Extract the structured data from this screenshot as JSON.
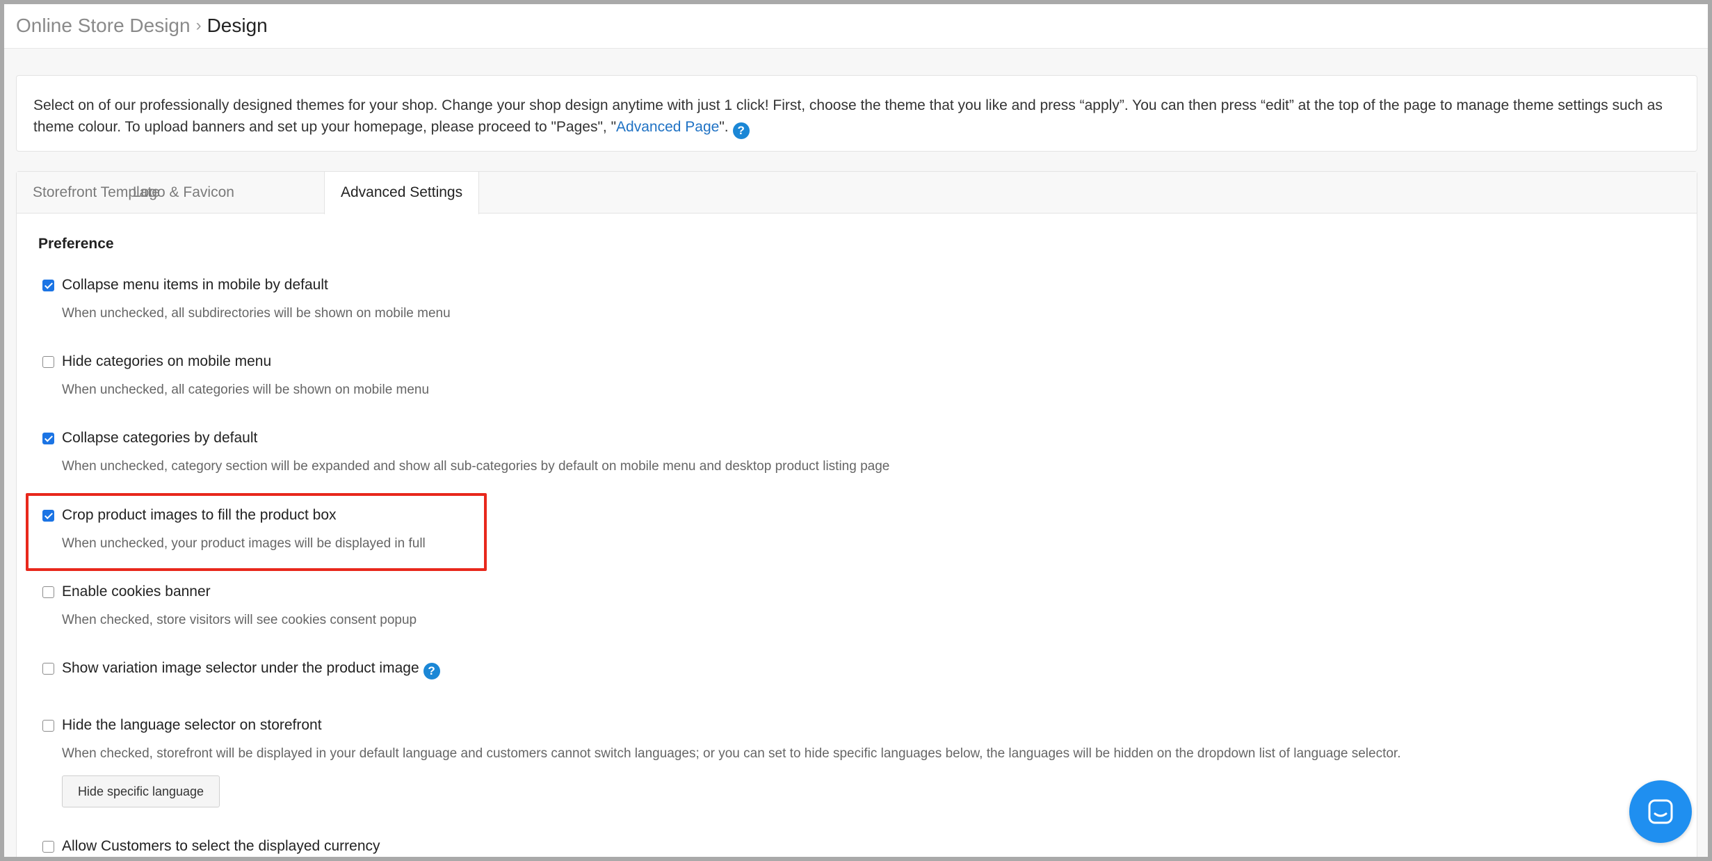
{
  "breadcrumb": {
    "parent": "Online Store Design",
    "separator": "›",
    "current": "Design"
  },
  "intro": {
    "text_before_link": "Select on of our professionally designed themes for your shop. Change your shop design anytime with just 1 click! First, choose the theme that you like and press “apply”. You can then press “edit” at the top of the page to manage theme settings such as theme colour. To upload banners and set up your homepage, please proceed to \"Pages\", \"",
    "link_text": "Advanced Page",
    "text_after_link": "\".",
    "help_icon": "?"
  },
  "tabs": [
    {
      "label": "Storefront Template",
      "active": false
    },
    {
      "label": "Logo & Favicon",
      "active": false
    },
    {
      "label": "Advanced Settings",
      "active": true
    }
  ],
  "preference": {
    "title": "Preference",
    "options": [
      {
        "label": "Collapse menu items in mobile by default",
        "checked": true,
        "description": "When unchecked, all subdirectories will be shown on mobile menu"
      },
      {
        "label": "Hide categories on mobile menu",
        "checked": false,
        "description": "When unchecked, all categories will be shown on mobile menu"
      },
      {
        "label": "Collapse categories by default",
        "checked": true,
        "description": "When unchecked, category section will be expanded and show all sub-categories by default on mobile menu and desktop product listing page"
      },
      {
        "label": "Crop product images to fill the product box",
        "checked": true,
        "description": "When unchecked, your product images will be displayed in full"
      },
      {
        "label": "Enable cookies banner",
        "checked": false,
        "description": "When checked, store visitors will see cookies consent popup"
      },
      {
        "label": "Show variation image selector under the product image",
        "checked": false,
        "help_icon": "?"
      },
      {
        "label": "Hide the language selector on storefront",
        "checked": false,
        "description": "When checked, storefront will be displayed in your default language and customers cannot switch languages; or you can set to hide specific languages below, the languages will be hidden on the dropdown list of language selector.",
        "button_label": "Hide specific language"
      },
      {
        "label": "Allow Customers to select the displayed currency",
        "checked": false
      }
    ]
  },
  "highlight_color": "#e8281c",
  "accent_color": "#1b74e4",
  "chat_icon": "chat-bubble-icon"
}
